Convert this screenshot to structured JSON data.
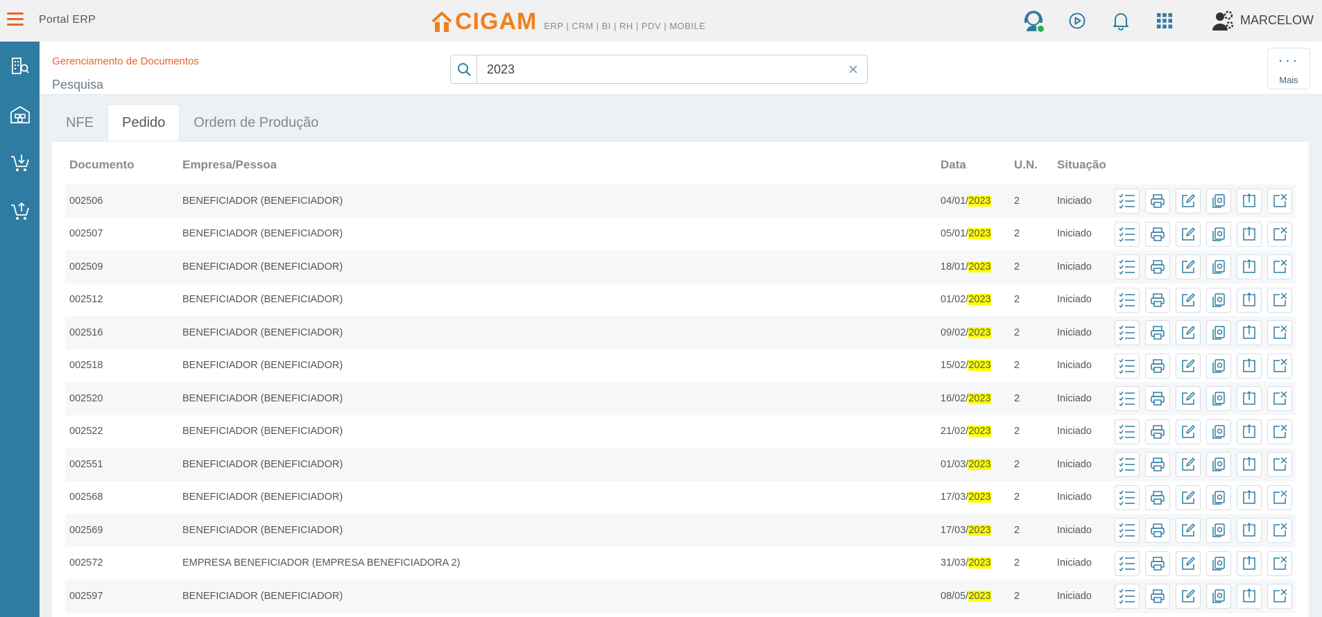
{
  "header": {
    "app_title": "Portal ERP",
    "logo_text": "CIGAM",
    "logo_tagline": "ERP | CRM | BI | RH | PDV | MOBILE",
    "user_name": "MARCELOW"
  },
  "page": {
    "breadcrumb": "Gerenciamento de Documentos",
    "title": "Pesquisa",
    "more_label": "Mais"
  },
  "search": {
    "value": "2023"
  },
  "tabs": [
    {
      "label": "NFE"
    },
    {
      "label": "Pedido"
    },
    {
      "label": "Ordem de Produção"
    }
  ],
  "table": {
    "headers": {
      "document": "Documento",
      "company": "Empresa/Pessoa",
      "date": "Data",
      "unit": "U.N.",
      "status": "Situação"
    },
    "rows": [
      {
        "document": "002506",
        "company": "BENEFICIADOR (BENEFICIADOR)",
        "date_prefix": "04/01/",
        "date_year": "2023",
        "unit": "2",
        "status": "Iniciado"
      },
      {
        "document": "002507",
        "company": "BENEFICIADOR (BENEFICIADOR)",
        "date_prefix": "05/01/",
        "date_year": "2023",
        "unit": "2",
        "status": "Iniciado"
      },
      {
        "document": "002509",
        "company": "BENEFICIADOR (BENEFICIADOR)",
        "date_prefix": "18/01/",
        "date_year": "2023",
        "unit": "2",
        "status": "Iniciado"
      },
      {
        "document": "002512",
        "company": "BENEFICIADOR (BENEFICIADOR)",
        "date_prefix": "01/02/",
        "date_year": "2023",
        "unit": "2",
        "status": "Iniciado"
      },
      {
        "document": "002516",
        "company": "BENEFICIADOR (BENEFICIADOR)",
        "date_prefix": "09/02/",
        "date_year": "2023",
        "unit": "2",
        "status": "Iniciado"
      },
      {
        "document": "002518",
        "company": "BENEFICIADOR (BENEFICIADOR)",
        "date_prefix": "15/02/",
        "date_year": "2023",
        "unit": "2",
        "status": "Iniciado"
      },
      {
        "document": "002520",
        "company": "BENEFICIADOR (BENEFICIADOR)",
        "date_prefix": "16/02/",
        "date_year": "2023",
        "unit": "2",
        "status": "Iniciado"
      },
      {
        "document": "002522",
        "company": "BENEFICIADOR (BENEFICIADOR)",
        "date_prefix": "21/02/",
        "date_year": "2023",
        "unit": "2",
        "status": "Iniciado"
      },
      {
        "document": "002551",
        "company": "BENEFICIADOR (BENEFICIADOR)",
        "date_prefix": "01/03/",
        "date_year": "2023",
        "unit": "2",
        "status": "Iniciado"
      },
      {
        "document": "002568",
        "company": "BENEFICIADOR (BENEFICIADOR)",
        "date_prefix": "17/03/",
        "date_year": "2023",
        "unit": "2",
        "status": "Iniciado"
      },
      {
        "document": "002569",
        "company": "BENEFICIADOR (BENEFICIADOR)",
        "date_prefix": "17/03/",
        "date_year": "2023",
        "unit": "2",
        "status": "Iniciado"
      },
      {
        "document": "002572",
        "company": "EMPRESA BENEFICIADOR (EMPRESA BENEFICIADORA 2)",
        "date_prefix": "31/03/",
        "date_year": "2023",
        "unit": "2",
        "status": "Iniciado"
      },
      {
        "document": "002597",
        "company": "BENEFICIADOR (BENEFICIADOR)",
        "date_prefix": "08/05/",
        "date_year": "2023",
        "unit": "2",
        "status": "Iniciado"
      }
    ]
  },
  "colors": {
    "accent": "#e8632a",
    "sidebar": "#2f7ca2",
    "icon": "#2f7ca2",
    "highlight": "#ffff00"
  }
}
